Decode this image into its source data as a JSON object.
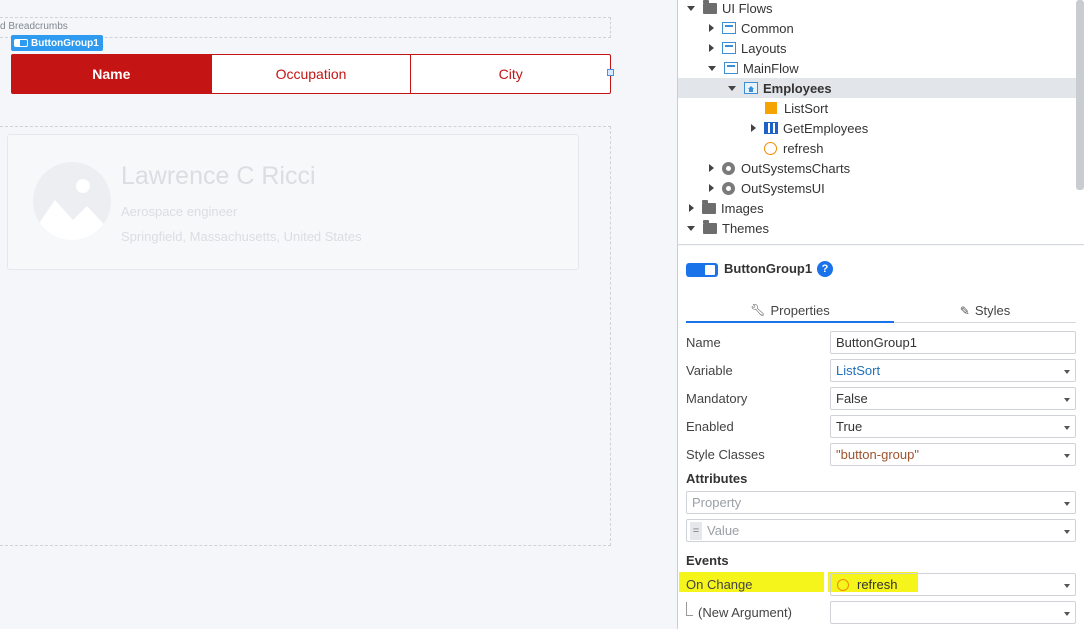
{
  "canvas": {
    "breadcrumbs_label": "d Breadcrumbs",
    "selected_tag": "ButtonGroup1",
    "button_group": [
      "Name",
      "Occupation",
      "City"
    ],
    "card": {
      "name": "Lawrence C Ricci",
      "occupation": "Aerospace engineer",
      "location": "Springfield, Massachusetts, United States"
    }
  },
  "tree": {
    "items": [
      {
        "label": "UI Flows",
        "expander": "down",
        "icon": "folder-icon"
      },
      {
        "label": "Common",
        "expander": "right",
        "icon": "flow-icon"
      },
      {
        "label": "Layouts",
        "expander": "right",
        "icon": "flow-icon"
      },
      {
        "label": "MainFlow",
        "expander": "down",
        "icon": "flow-icon"
      },
      {
        "label": "Employees",
        "expander": "down",
        "icon": "screen-icon",
        "selected": true
      },
      {
        "label": "ListSort",
        "expander": "none",
        "icon": "local-variable-icon"
      },
      {
        "label": "GetEmployees",
        "expander": "right",
        "icon": "aggregate-icon"
      },
      {
        "label": "refresh",
        "expander": "none",
        "icon": "client-action-icon"
      },
      {
        "label": "OutSystemsCharts",
        "expander": "right",
        "icon": "module-icon"
      },
      {
        "label": "OutSystemsUI",
        "expander": "right",
        "icon": "module-icon"
      },
      {
        "label": "Images",
        "expander": "right",
        "icon": "folder-icon"
      },
      {
        "label": "Themes",
        "expander": "down",
        "icon": "folder-icon"
      }
    ]
  },
  "props": {
    "title": "ButtonGroup1",
    "help": "?",
    "tabs": {
      "properties": "Properties",
      "styles": "Styles"
    },
    "rows": {
      "name_label": "Name",
      "name_value": "ButtonGroup1",
      "variable_label": "Variable",
      "variable_value": "ListSort",
      "mandatory_label": "Mandatory",
      "mandatory_value": "False",
      "enabled_label": "Enabled",
      "enabled_value": "True",
      "style_label": "Style Classes",
      "style_value": "\"button-group\""
    },
    "attributes": {
      "heading": "Attributes",
      "property_placeholder": "Property",
      "eq": "=",
      "value_placeholder": "Value"
    },
    "events": {
      "heading": "Events",
      "on_change_label": "On Change",
      "on_change_value": "refresh",
      "new_argument_label": "(New Argument)"
    }
  },
  "colors": {
    "button_primary": "#c41414",
    "selection_blue": "#2f9bf0",
    "highlight": "#f5f51c"
  }
}
